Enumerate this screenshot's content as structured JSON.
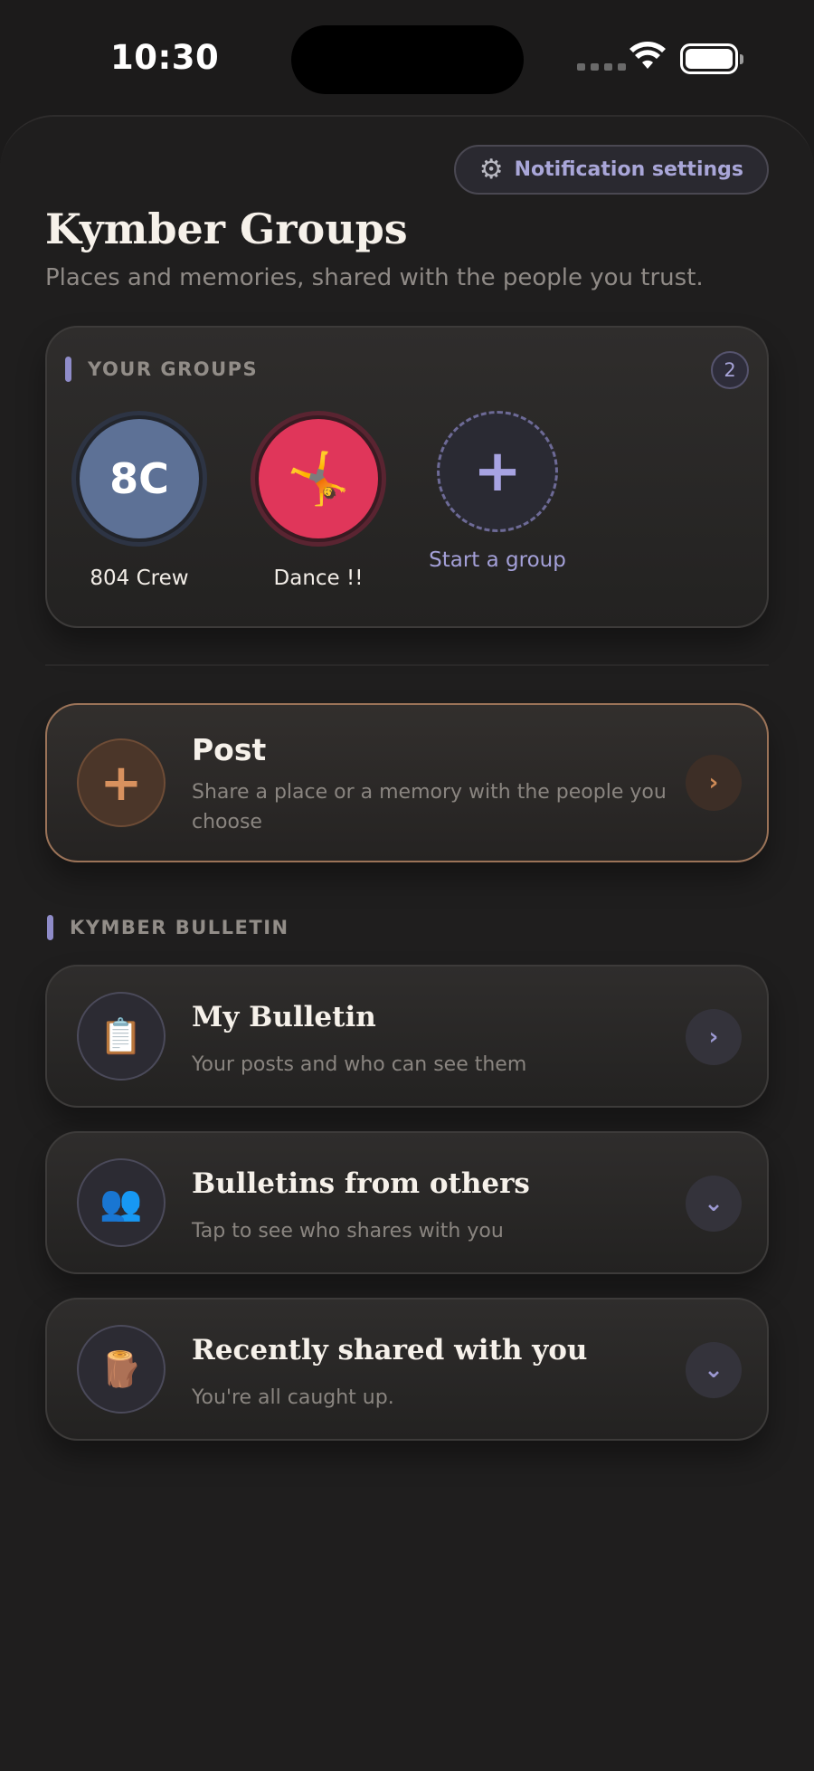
{
  "status_bar": {
    "time": "10:30"
  },
  "header": {
    "notification_button": "Notification settings",
    "title": "Kymber Groups",
    "subtitle": "Places and memories, shared with the people you trust."
  },
  "groups": {
    "label": "YOUR GROUPS",
    "count": "2",
    "items": [
      {
        "name": "804 Crew",
        "initials": "8C",
        "color": "#5d7196"
      },
      {
        "name": "Dance !!",
        "emoji": "🤸",
        "color": "#e0365a"
      }
    ],
    "start_label": "Start a group",
    "start_glyph": "+"
  },
  "post": {
    "glyph": "+",
    "title": "Post",
    "subtitle": "Share a place or a memory with the people you choose",
    "chevron": "›"
  },
  "bulletin": {
    "label": "KYMBER BULLETIN",
    "items": [
      {
        "icon": "📋",
        "title": "My Bulletin",
        "subtitle": "Your posts and who can see them",
        "chevron": "›"
      },
      {
        "icon": "👥",
        "title": "Bulletins from others",
        "subtitle": "Tap to see who shares with you",
        "chevron": "⌄"
      },
      {
        "icon": "🪵",
        "title": "Recently shared with you",
        "subtitle": "You're all caught up.",
        "chevron": "⌄"
      }
    ]
  }
}
